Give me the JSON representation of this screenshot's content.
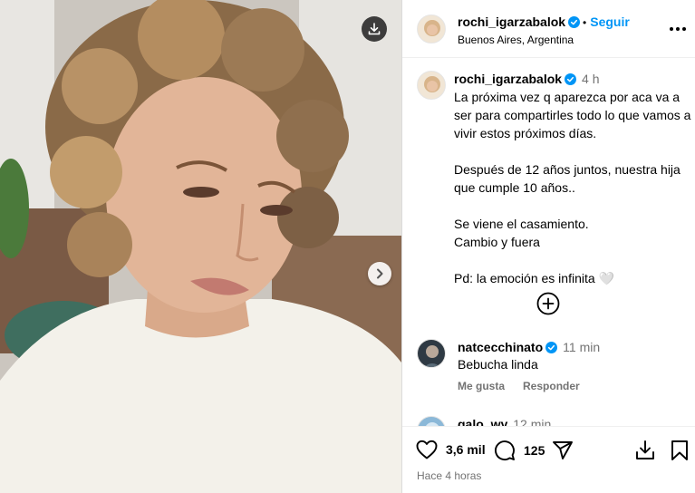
{
  "post": {
    "username": "rochi_igarzabalok",
    "follow_label": "Seguir",
    "location": "Buenos Aires, Argentina",
    "caption_time": "4 h",
    "caption_paragraphs": [
      "La próxima vez q aparezca por aca va a ser para compartirles todo lo que vamos a vivir estos próximos días.",
      "Después de 12 años juntos, nuestra hija que cumple 10 años..",
      "Se viene el casamiento.",
      "Cambio y fuera",
      "Pd: la emoción es infinita 🤍"
    ]
  },
  "comments": [
    {
      "username": "natcecchinato",
      "time": "11 min",
      "text": "Bebucha linda",
      "like_label": "Me gusta",
      "reply_label": "Responder"
    },
    {
      "username": "galo_wy",
      "time": "12 min"
    }
  ],
  "footer": {
    "likes": "3,6 mil",
    "comments": "125",
    "posted_ago": "Hace 4 horas"
  },
  "colors": {
    "accent": "#0095f6",
    "verified": "#0095f6",
    "muted": "#737373"
  },
  "icons": {
    "download": "download-icon",
    "next": "chevron-right-icon",
    "more": "more-horizontal-icon",
    "add_comment": "plus-circle-icon",
    "like": "heart-icon",
    "comment": "comment-icon",
    "share": "send-icon",
    "save": "bookmark-icon"
  }
}
